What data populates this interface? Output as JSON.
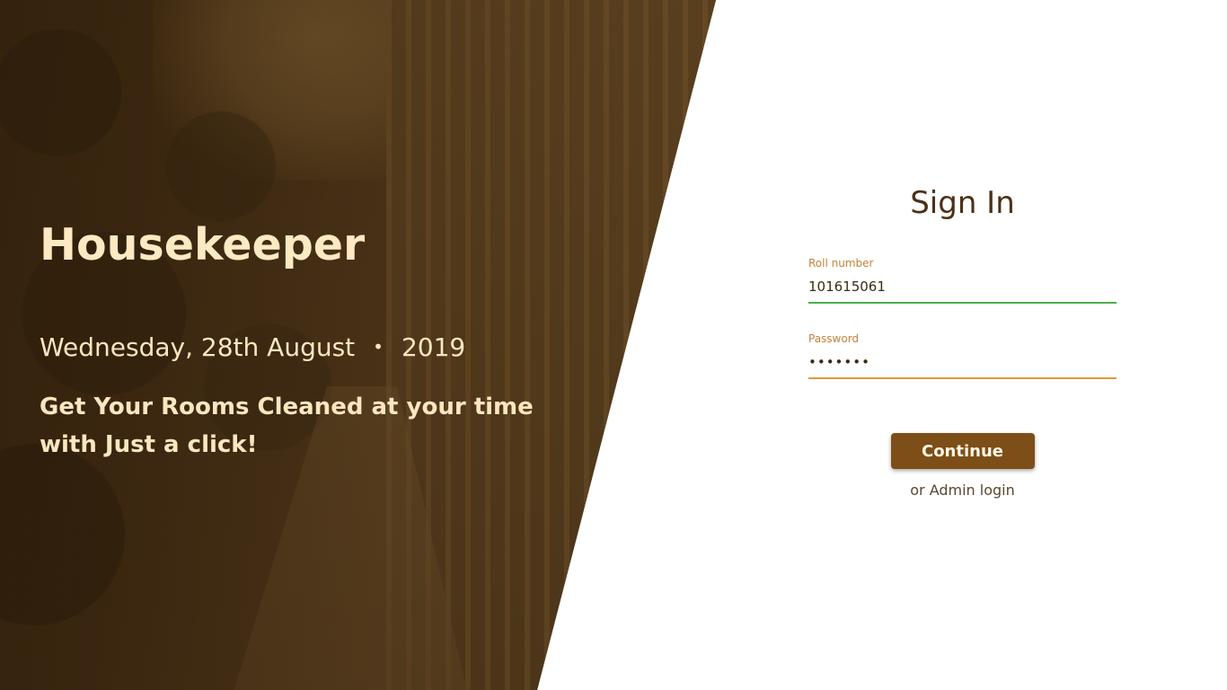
{
  "hero": {
    "app_title": "Housekeeper",
    "date": "Wednesday, 28th August",
    "separator": "•",
    "year": "2019",
    "tagline": "Get Your Rooms Cleaned at your time with Just a click!"
  },
  "signin": {
    "title": "Sign In",
    "roll_label": "Roll number",
    "roll_value": "101615061",
    "password_label": "Password",
    "password_value": "•••••••",
    "continue_label": "Continue",
    "admin_prefix": "or",
    "admin_link": "Admin login"
  },
  "colors": {
    "accent": "#7d4e17",
    "field_ok": "#4caf50",
    "field_focus": "#e09a3a",
    "label": "#c2823a"
  }
}
